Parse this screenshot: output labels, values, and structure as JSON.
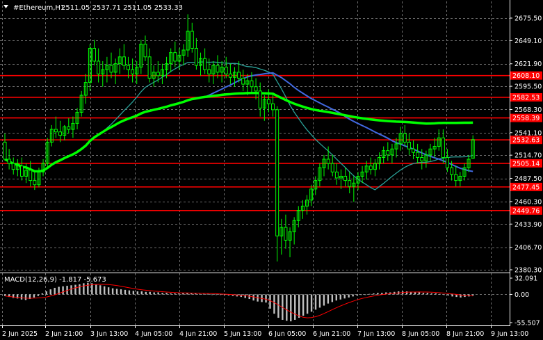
{
  "header": {
    "symbol": "#Ethereum,H1",
    "ohlc": "2511.05 2537.71 2511.05 2533.33"
  },
  "macd": {
    "label": "MACD(12,26,9) -1.817 -5.673",
    "axis_ticks": [
      "32.091",
      "0.00",
      "-55.507"
    ]
  },
  "colors": {
    "background": "#000000",
    "grid": "#6e6e6e",
    "candle": "#00ff00",
    "levels": "#ff0000",
    "ma_green": "#00ff00",
    "ma_blue": "#4169e1",
    "ma_teal": "#2aa198",
    "macd_hist": "#c0c0c0",
    "macd_signal": "#ff0000"
  },
  "chart_data": {
    "type": "candlestick",
    "price_ticks": [
      "2675.50",
      "2649.10",
      "2621.90",
      "2595.50",
      "2568.30",
      "2541.10",
      "2514.70",
      "2487.50",
      "2460.30",
      "2433.90",
      "2406.70",
      "2380.30"
    ],
    "time_ticks": [
      "2 Jun 2025",
      "2 Jun 21:00",
      "3 Jun 13:00",
      "4 Jun 05:00",
      "4 Jun 21:00",
      "5 Jun 13:00",
      "6 Jun 05:00",
      "6 Jun 21:00",
      "7 Jun 13:00",
      "8 Jun 05:00",
      "8 Jun 21:00",
      "9 Jun 13:00"
    ],
    "horizontal_levels": [
      "2608.10",
      "2582.53",
      "2558.39",
      "2532.63",
      "2505.14",
      "2477.45",
      "2449.76"
    ],
    "last_price": "2533.33",
    "price_range": [
      2380.3,
      2675.5
    ],
    "macd_range": [
      -55.507,
      32.091
    ],
    "candles": [
      [
        2530,
        2540,
        2525,
        2510
      ],
      [
        2510,
        2522,
        2498,
        2505
      ],
      [
        2505,
        2512,
        2492,
        2498
      ],
      [
        2498,
        2510,
        2490,
        2502
      ],
      [
        2502,
        2512,
        2485,
        2490
      ],
      [
        2490,
        2505,
        2482,
        2497
      ],
      [
        2497,
        2508,
        2478,
        2485
      ],
      [
        2485,
        2495,
        2474,
        2480
      ],
      [
        2480,
        2500,
        2477,
        2495
      ],
      [
        2495,
        2510,
        2490,
        2505
      ],
      [
        2505,
        2535,
        2500,
        2530
      ],
      [
        2530,
        2550,
        2525,
        2545
      ],
      [
        2545,
        2560,
        2535,
        2542
      ],
      [
        2542,
        2555,
        2530,
        2538
      ],
      [
        2538,
        2550,
        2532,
        2548
      ],
      [
        2548,
        2558,
        2540,
        2545
      ],
      [
        2545,
        2560,
        2535,
        2552
      ],
      [
        2552,
        2570,
        2545,
        2565
      ],
      [
        2565,
        2590,
        2560,
        2585
      ],
      [
        2585,
        2610,
        2575,
        2600
      ],
      [
        2600,
        2645,
        2590,
        2640
      ],
      [
        2640,
        2650,
        2620,
        2625
      ],
      [
        2625,
        2640,
        2600,
        2610
      ],
      [
        2610,
        2625,
        2595,
        2615
      ],
      [
        2615,
        2630,
        2600,
        2620
      ],
      [
        2620,
        2635,
        2605,
        2612
      ],
      [
        2612,
        2628,
        2598,
        2622
      ],
      [
        2622,
        2640,
        2610,
        2630
      ],
      [
        2630,
        2645,
        2615,
        2620
      ],
      [
        2620,
        2630,
        2605,
        2615
      ],
      [
        2615,
        2628,
        2600,
        2610
      ],
      [
        2610,
        2625,
        2598,
        2618
      ],
      [
        2618,
        2650,
        2610,
        2645
      ],
      [
        2645,
        2655,
        2625,
        2630
      ],
      [
        2630,
        2640,
        2600,
        2605
      ],
      [
        2605,
        2620,
        2595,
        2612
      ],
      [
        2612,
        2625,
        2600,
        2608
      ],
      [
        2608,
        2622,
        2598,
        2615
      ],
      [
        2615,
        2630,
        2605,
        2622
      ],
      [
        2622,
        2640,
        2612,
        2635
      ],
      [
        2635,
        2648,
        2618,
        2625
      ],
      [
        2625,
        2640,
        2615,
        2632
      ],
      [
        2632,
        2645,
        2620,
        2638
      ],
      [
        2638,
        2680,
        2630,
        2660
      ],
      [
        2660,
        2670,
        2635,
        2640
      ],
      [
        2640,
        2652,
        2615,
        2620
      ],
      [
        2620,
        2635,
        2608,
        2628
      ],
      [
        2628,
        2640,
        2610,
        2615
      ],
      [
        2615,
        2628,
        2600,
        2610
      ],
      [
        2610,
        2625,
        2598,
        2620
      ],
      [
        2620,
        2632,
        2605,
        2612
      ],
      [
        2612,
        2625,
        2600,
        2618
      ],
      [
        2618,
        2630,
        2605,
        2610
      ],
      [
        2610,
        2622,
        2598,
        2606
      ],
      [
        2606,
        2618,
        2595,
        2612
      ],
      [
        2612,
        2625,
        2600,
        2605
      ],
      [
        2605,
        2615,
        2590,
        2598
      ],
      [
        2598,
        2610,
        2585,
        2602
      ],
      [
        2602,
        2612,
        2588,
        2595
      ],
      [
        2595,
        2605,
        2580,
        2590
      ],
      [
        2590,
        2600,
        2560,
        2570
      ],
      [
        2570,
        2585,
        2555,
        2580
      ],
      [
        2580,
        2592,
        2565,
        2575
      ],
      [
        2575,
        2588,
        2560,
        2568
      ],
      [
        2568,
        2572,
        2390,
        2420
      ],
      [
        2420,
        2440,
        2398,
        2430
      ],
      [
        2430,
        2445,
        2405,
        2415
      ],
      [
        2415,
        2430,
        2395,
        2425
      ],
      [
        2425,
        2442,
        2410,
        2438
      ],
      [
        2438,
        2455,
        2430,
        2450
      ],
      [
        2450,
        2462,
        2440,
        2455
      ],
      [
        2455,
        2468,
        2445,
        2462
      ],
      [
        2462,
        2480,
        2455,
        2475
      ],
      [
        2475,
        2490,
        2468,
        2485
      ],
      [
        2485,
        2505,
        2478,
        2500
      ],
      [
        2500,
        2515,
        2490,
        2510
      ],
      [
        2510,
        2525,
        2498,
        2505
      ],
      [
        2505,
        2515,
        2490,
        2495
      ],
      [
        2495,
        2505,
        2480,
        2488
      ],
      [
        2488,
        2498,
        2475,
        2490
      ],
      [
        2490,
        2500,
        2478,
        2485
      ],
      [
        2485,
        2495,
        2470,
        2478
      ],
      [
        2478,
        2490,
        2460,
        2482
      ],
      [
        2482,
        2495,
        2474,
        2490
      ],
      [
        2490,
        2502,
        2482,
        2495
      ],
      [
        2495,
        2508,
        2486,
        2502
      ],
      [
        2502,
        2512,
        2492,
        2498
      ],
      [
        2498,
        2510,
        2490,
        2505
      ],
      [
        2505,
        2518,
        2498,
        2512
      ],
      [
        2512,
        2525,
        2505,
        2520
      ],
      [
        2520,
        2530,
        2508,
        2515
      ],
      [
        2515,
        2528,
        2505,
        2522
      ],
      [
        2522,
        2535,
        2512,
        2528
      ],
      [
        2528,
        2548,
        2520,
        2540
      ],
      [
        2540,
        2550,
        2525,
        2530
      ],
      [
        2530,
        2540,
        2515,
        2522
      ],
      [
        2522,
        2532,
        2510,
        2518
      ],
      [
        2518,
        2528,
        2505,
        2512
      ],
      [
        2512,
        2522,
        2498,
        2508
      ],
      [
        2508,
        2520,
        2500,
        2515
      ],
      [
        2515,
        2528,
        2508,
        2522
      ],
      [
        2522,
        2535,
        2512,
        2525
      ],
      [
        2525,
        2545,
        2520,
        2535
      ],
      [
        2535,
        2545,
        2505,
        2512
      ],
      [
        2512,
        2522,
        2495,
        2500
      ],
      [
        2500,
        2508,
        2485,
        2492
      ],
      [
        2492,
        2502,
        2478,
        2485
      ],
      [
        2485,
        2495,
        2478,
        2490
      ],
      [
        2490,
        2505,
        2485,
        2500
      ],
      [
        2500,
        2515,
        2495,
        2510
      ],
      [
        2511,
        2538,
        2511,
        2533
      ]
    ],
    "macd_hist": [
      -3,
      -5,
      -7,
      -8,
      -10,
      -11,
      -9,
      -6,
      -3,
      2,
      6,
      10,
      13,
      15,
      16,
      17,
      18,
      19,
      20,
      22,
      23,
      22,
      20,
      18,
      16,
      14,
      12,
      11,
      10,
      9,
      8,
      7,
      6,
      6,
      5,
      5,
      4,
      4,
      3,
      3,
      2,
      2,
      2,
      3,
      3,
      2,
      2,
      1,
      1,
      1,
      0,
      0,
      -1,
      -1,
      -2,
      -3,
      -4,
      -5,
      -7,
      -9,
      -12,
      -14,
      -15,
      -16,
      -28,
      -38,
      -46,
      -50,
      -52,
      -53,
      -50,
      -46,
      -42,
      -38,
      -34,
      -30,
      -26,
      -22,
      -18,
      -15,
      -12,
      -10,
      -8,
      -6,
      -4,
      -2,
      -1,
      0,
      1,
      2,
      3,
      3,
      4,
      4,
      5,
      6,
      6,
      6,
      5,
      4,
      4,
      3,
      3,
      2,
      2,
      1,
      0,
      -2,
      -4,
      -5,
      -6,
      -5,
      -4,
      -2
    ]
  }
}
